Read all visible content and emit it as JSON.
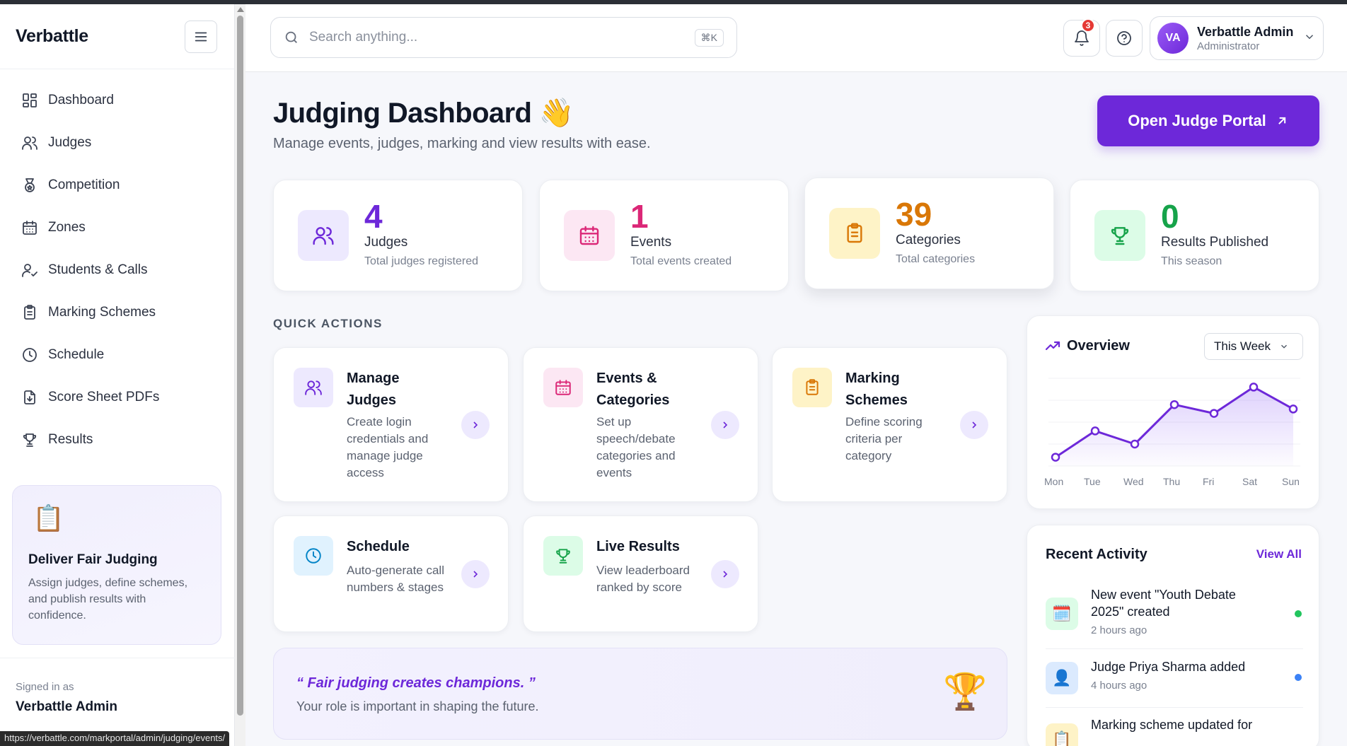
{
  "sidebar": {
    "brand": "Verbattle",
    "items": [
      {
        "label": "Dashboard",
        "icon": "dashboard-icon"
      },
      {
        "label": "Judges",
        "icon": "users-icon"
      },
      {
        "label": "Competition",
        "icon": "medal-icon"
      },
      {
        "label": "Zones",
        "icon": "calendar-icon"
      },
      {
        "label": "Students & Calls",
        "icon": "user-check-icon"
      },
      {
        "label": "Marking Schemes",
        "icon": "clipboard-icon"
      },
      {
        "label": "Schedule",
        "icon": "clock-icon"
      },
      {
        "label": "Score Sheet PDFs",
        "icon": "file-download-icon"
      },
      {
        "label": "Results",
        "icon": "trophy-icon"
      }
    ],
    "promo": {
      "title": "Deliver Fair Judging",
      "text": "Assign judges, define schemes, and publish results with confidence."
    },
    "signed_in_label": "Signed in as",
    "signed_in_name": "Verbattle Admin"
  },
  "status_url": "https://verbattle.com/markportal/admin/judging/events/",
  "header": {
    "search_placeholder": "Search anything...",
    "search_shortcut": "⌘K",
    "notification_count": "3",
    "user": {
      "initials": "VA",
      "name": "Verbattle Admin",
      "role": "Administrator"
    }
  },
  "main": {
    "title": "Judging Dashboard",
    "title_emoji": "👋",
    "subtitle": "Manage events, judges, marking and view results with ease.",
    "portal_button": "Open Judge Portal",
    "stats": [
      {
        "value": "4",
        "label": "Judges",
        "sub": "Total judges registered",
        "color": "#6d28d9",
        "bg": "#ede9fe"
      },
      {
        "value": "1",
        "label": "Events",
        "sub": "Total events created",
        "color": "#db2777",
        "bg": "#fce7f3"
      },
      {
        "value": "39",
        "label": "Categories",
        "sub": "Total categories",
        "color": "#d97706",
        "bg": "#fef3c7"
      },
      {
        "value": "0",
        "label": "Results Published",
        "sub": "This season",
        "color": "#16a34a",
        "bg": "#dcfce7"
      }
    ],
    "quick_actions_label": "QUICK ACTIONS",
    "quick_actions": [
      {
        "title": "Manage Judges",
        "desc": "Create login credentials and manage judge access"
      },
      {
        "title": "Events & Categories",
        "desc": "Set up speech/debate categories and events"
      },
      {
        "title": "Marking Schemes",
        "desc": "Define scoring criteria per category"
      },
      {
        "title": "Schedule",
        "desc": "Auto-generate call numbers & stages"
      },
      {
        "title": "Live Results",
        "desc": "View leaderboard ranked by score"
      }
    ],
    "quote": {
      "text": "“ Fair judging creates champions. ”",
      "sub": "Your role is important in shaping the future."
    }
  },
  "overview": {
    "title": "Overview",
    "range": "This Week"
  },
  "chart_data": {
    "type": "area",
    "categories": [
      "Mon",
      "Tue",
      "Wed",
      "Thu",
      "Fri",
      "Sat",
      "Sun"
    ],
    "values": [
      1,
      4,
      2.5,
      7,
      6,
      9,
      6.5
    ],
    "ylim": [
      0,
      10
    ],
    "grid": true,
    "color": "#6d28d9"
  },
  "activity": {
    "title": "Recent Activity",
    "view_all": "View All",
    "items": [
      {
        "text": "New event \"Youth Debate 2025\" created",
        "time": "2 hours ago",
        "icon": "calendar-icon",
        "dot": "#22c55e"
      },
      {
        "text": "Judge Priya Sharma added",
        "time": "4 hours ago",
        "icon": "user-icon",
        "dot": "#3b82f6"
      },
      {
        "text": "Marking scheme updated for",
        "time": "",
        "icon": "clipboard-icon",
        "dot": "#f59e0b"
      }
    ]
  }
}
